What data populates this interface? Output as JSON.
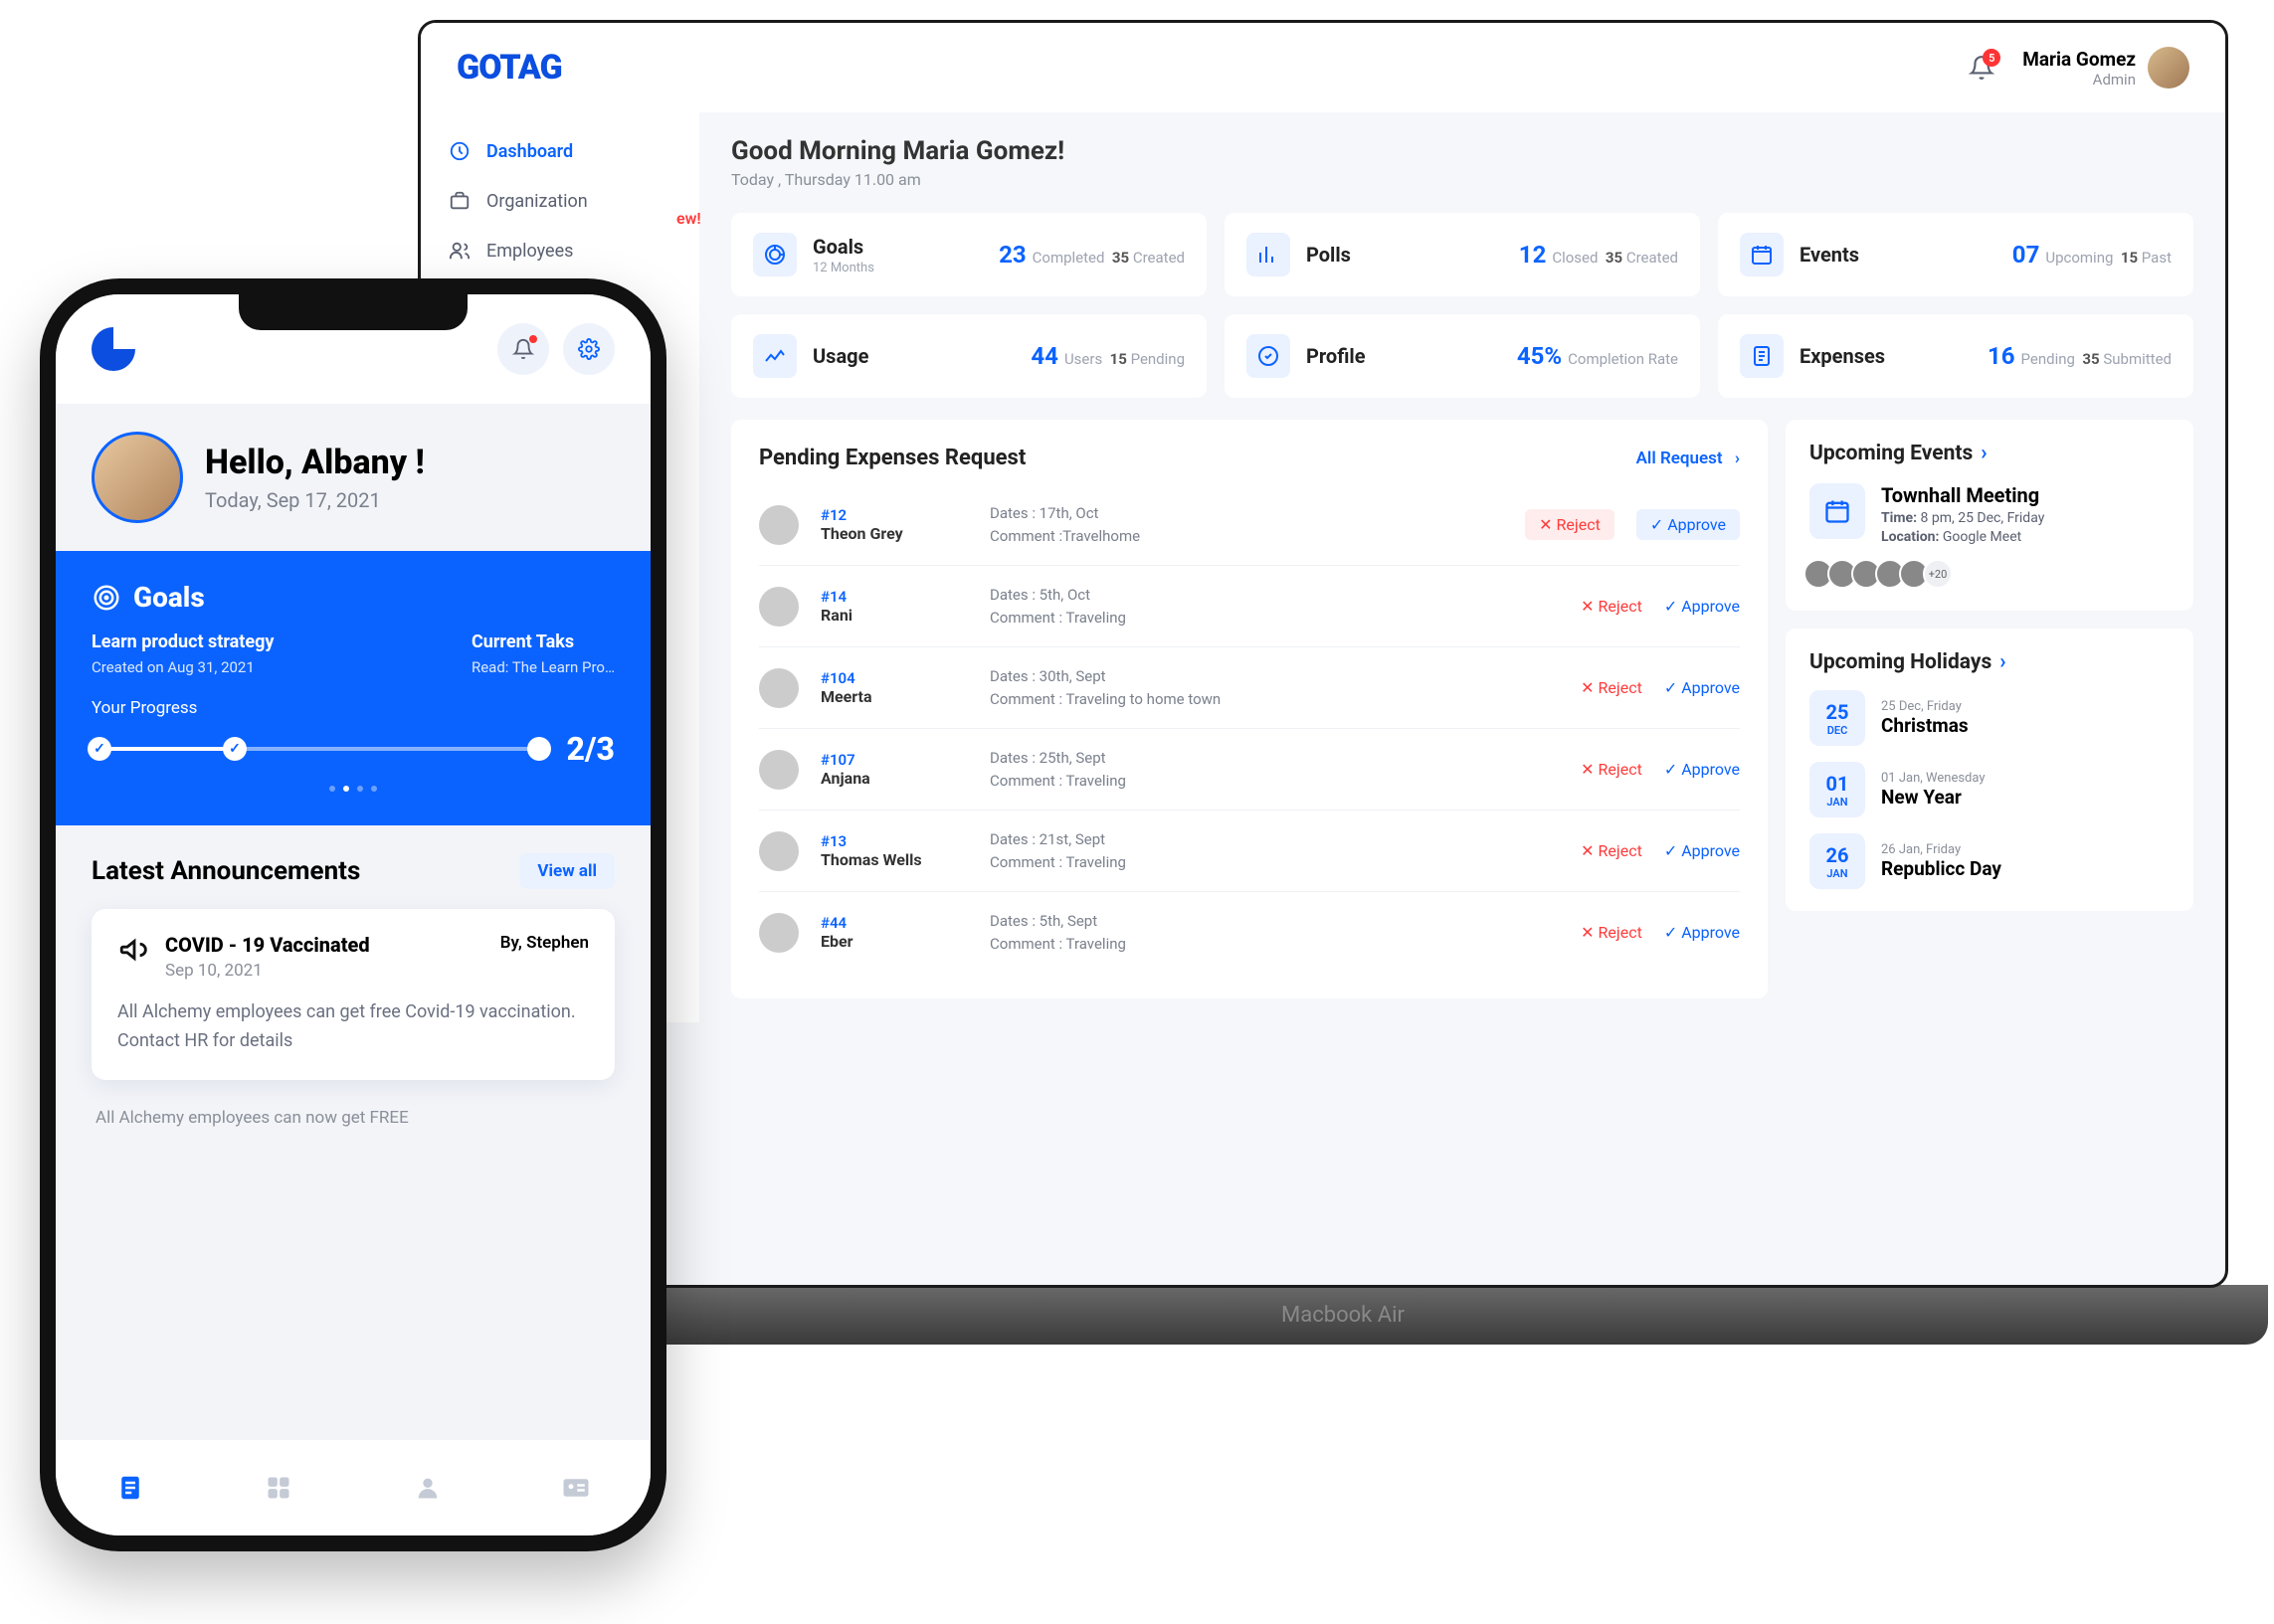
{
  "laptop": {
    "brand": "GOTAG",
    "notification_count": "5",
    "user": {
      "name": "Maria Gomez",
      "role": "Admin"
    },
    "sidebar": [
      {
        "label": "Dashboard",
        "active": true
      },
      {
        "label": "Organization",
        "active": false
      },
      {
        "label": "Employees",
        "active": false
      }
    ],
    "greeting": {
      "title": "Good Morning Maria Gomez!",
      "sub": "Today , Thursday 11.00 am"
    },
    "stats": [
      {
        "title": "Goals",
        "sub": "12 Months",
        "num": "23",
        "metric1": "Completed",
        "num2": "35",
        "metric2": "Created"
      },
      {
        "title": "Polls",
        "sub": "",
        "num": "12",
        "metric1": "Closed",
        "num2": "35",
        "metric2": "Created"
      },
      {
        "title": "Events",
        "sub": "",
        "num": "07",
        "metric1": "Upcoming",
        "num2": "15",
        "metric2": "Past"
      },
      {
        "title": "Usage",
        "sub": "",
        "num": "44",
        "metric1": "Users",
        "num2": "15",
        "metric2": "Pending"
      },
      {
        "title": "Profile",
        "sub": "",
        "num": "45%",
        "metric1": "Completion Rate",
        "num2": "",
        "metric2": ""
      },
      {
        "title": "Expenses",
        "sub": "",
        "num": "16",
        "metric1": "Pending",
        "num2": "35",
        "metric2": "Submitted"
      }
    ],
    "expenses": {
      "title": "Pending Expenses Request",
      "all_link": "All Request",
      "reject": "Reject",
      "approve": "Approve",
      "rows": [
        {
          "num": "#12",
          "name": "Theon Grey",
          "dates": "Dates : 17th, Oct",
          "comment": "Comment :Travelhome",
          "hover": true
        },
        {
          "num": "#14",
          "name": "Rani",
          "dates": "Dates : 5th, Oct",
          "comment": "Comment : Traveling"
        },
        {
          "num": "#104",
          "name": "Meerta",
          "dates": "Dates : 30th, Sept",
          "comment": "Comment : Traveling  to home town"
        },
        {
          "num": "#107",
          "name": "Anjana",
          "dates": "Dates : 25th, Sept",
          "comment": "Comment : Traveling"
        },
        {
          "num": "#13",
          "name": "Thomas Wells",
          "dates": "Dates : 21st, Sept",
          "comment": "Comment : Traveling"
        },
        {
          "num": "#44",
          "name": "Eber",
          "dates": "Dates : 5th, Sept",
          "comment": "Comment : Traveling"
        }
      ]
    },
    "upcoming_events": {
      "title": "Upcoming Events",
      "event_name": "Townhall Meeting",
      "time_label": "Time:",
      "time": "8 pm, 25 Dec, Friday",
      "loc_label": "Location:",
      "loc": "Google Meet",
      "more": "+20"
    },
    "holidays": {
      "title": "Upcoming Holidays",
      "items": [
        {
          "day": "25",
          "mon": "DEC",
          "sub": "25 Dec, Friday",
          "name": "Christmas"
        },
        {
          "day": "01",
          "mon": "JAN",
          "sub": "01 Jan, Wenesday",
          "name": "New Year"
        },
        {
          "day": "26",
          "mon": "JAN",
          "sub": "26 Jan, Friday",
          "name": "Republicc Day"
        }
      ]
    },
    "base_label": "Macbook Air"
  },
  "phone": {
    "hello": "Hello, Albany !",
    "today": "Today, Sep 17, 2021",
    "truncated_newtag": "ew!",
    "goals": {
      "title": "Goals",
      "task": "Learn product strategy",
      "created": "Created on Aug 31, 2021",
      "current_label": "Current Taks",
      "current_task": "Read: The Learn Pro…",
      "progress_label": "Your Progress",
      "fraction": "2/3"
    },
    "announcements": {
      "title": "Latest Announcements",
      "view_all": "View all",
      "card": {
        "title": "COVID - 19 Vaccinated",
        "by": "By, Stephen",
        "date": "Sep 10, 2021",
        "body": "All Alchemy employees can get free Covid-19 vaccination. Contact HR for details"
      },
      "peek": "All Alchemy employees can now get FREE"
    }
  }
}
